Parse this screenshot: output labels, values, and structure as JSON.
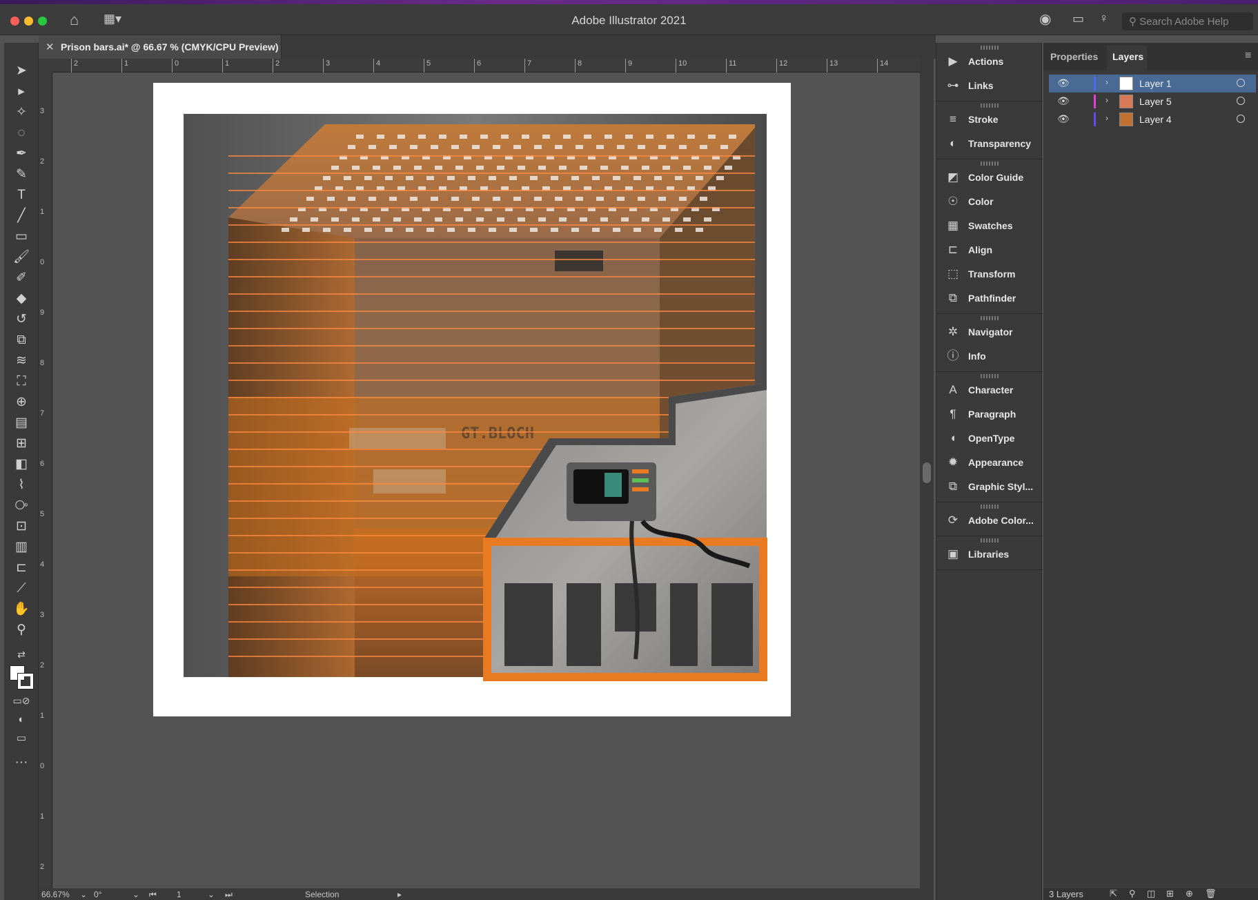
{
  "app": {
    "title": "Adobe Illustrator 2021",
    "search_placeholder": "Search Adobe Help"
  },
  "document": {
    "tab_label": "Prison bars.ai* @ 66.67 % (CMYK/CPU Preview)"
  },
  "rulers": {
    "horizontal": [
      "2",
      "1",
      "0",
      "1",
      "2",
      "3",
      "4",
      "5",
      "6",
      "7",
      "8",
      "9",
      "10",
      "11",
      "12",
      "13",
      "14"
    ],
    "vertical": [
      "3",
      "2",
      "1",
      "0",
      "9",
      "8",
      "7",
      "6",
      "5",
      "4",
      "3",
      "2",
      "1",
      "0",
      "1",
      "2"
    ]
  },
  "artwork": {
    "sign_text": "GT.BLOCH"
  },
  "statusbar": {
    "zoom": "66.67%",
    "rotation": "0°",
    "artboard": "1",
    "tool": "Selection"
  },
  "panels": {
    "groups": [
      [
        {
          "label": "Actions",
          "icon": "play-icon"
        },
        {
          "label": "Links",
          "icon": "link-icon"
        }
      ],
      [
        {
          "label": "Stroke",
          "icon": "stroke-icon"
        },
        {
          "label": "Transparency",
          "icon": "transparency-icon"
        }
      ],
      [
        {
          "label": "Color Guide",
          "icon": "color-guide-icon"
        },
        {
          "label": "Color",
          "icon": "color-icon"
        },
        {
          "label": "Swatches",
          "icon": "swatches-icon"
        },
        {
          "label": "Align",
          "icon": "align-icon"
        },
        {
          "label": "Transform",
          "icon": "transform-icon"
        },
        {
          "label": "Pathfinder",
          "icon": "pathfinder-icon"
        }
      ],
      [
        {
          "label": "Navigator",
          "icon": "navigator-icon"
        },
        {
          "label": "Info",
          "icon": "info-icon"
        }
      ],
      [
        {
          "label": "Character",
          "icon": "character-icon"
        },
        {
          "label": "Paragraph",
          "icon": "paragraph-icon"
        },
        {
          "label": "OpenType",
          "icon": "opentype-icon"
        },
        {
          "label": "Appearance",
          "icon": "appearance-icon"
        },
        {
          "label": "Graphic Styl...",
          "icon": "graphic-styles-icon"
        }
      ],
      [
        {
          "label": "Adobe Color...",
          "icon": "adobe-color-icon"
        }
      ],
      [
        {
          "label": "Libraries",
          "icon": "libraries-icon"
        }
      ]
    ]
  },
  "right_panel": {
    "tabs": [
      "Properties",
      "Layers"
    ],
    "active_tab": "Layers",
    "layers": [
      {
        "name": "Layer 1",
        "color": "#4b6cf0",
        "selected": true
      },
      {
        "name": "Layer 5",
        "color": "#e040d8",
        "selected": false
      },
      {
        "name": "Layer 4",
        "color": "#6a4af0",
        "selected": false
      }
    ],
    "footer": "3 Layers"
  },
  "colors": {
    "accent_orange": "#e87a22",
    "selection_blue": "#4a6a96",
    "ui_dark": "#3a3a3a"
  }
}
